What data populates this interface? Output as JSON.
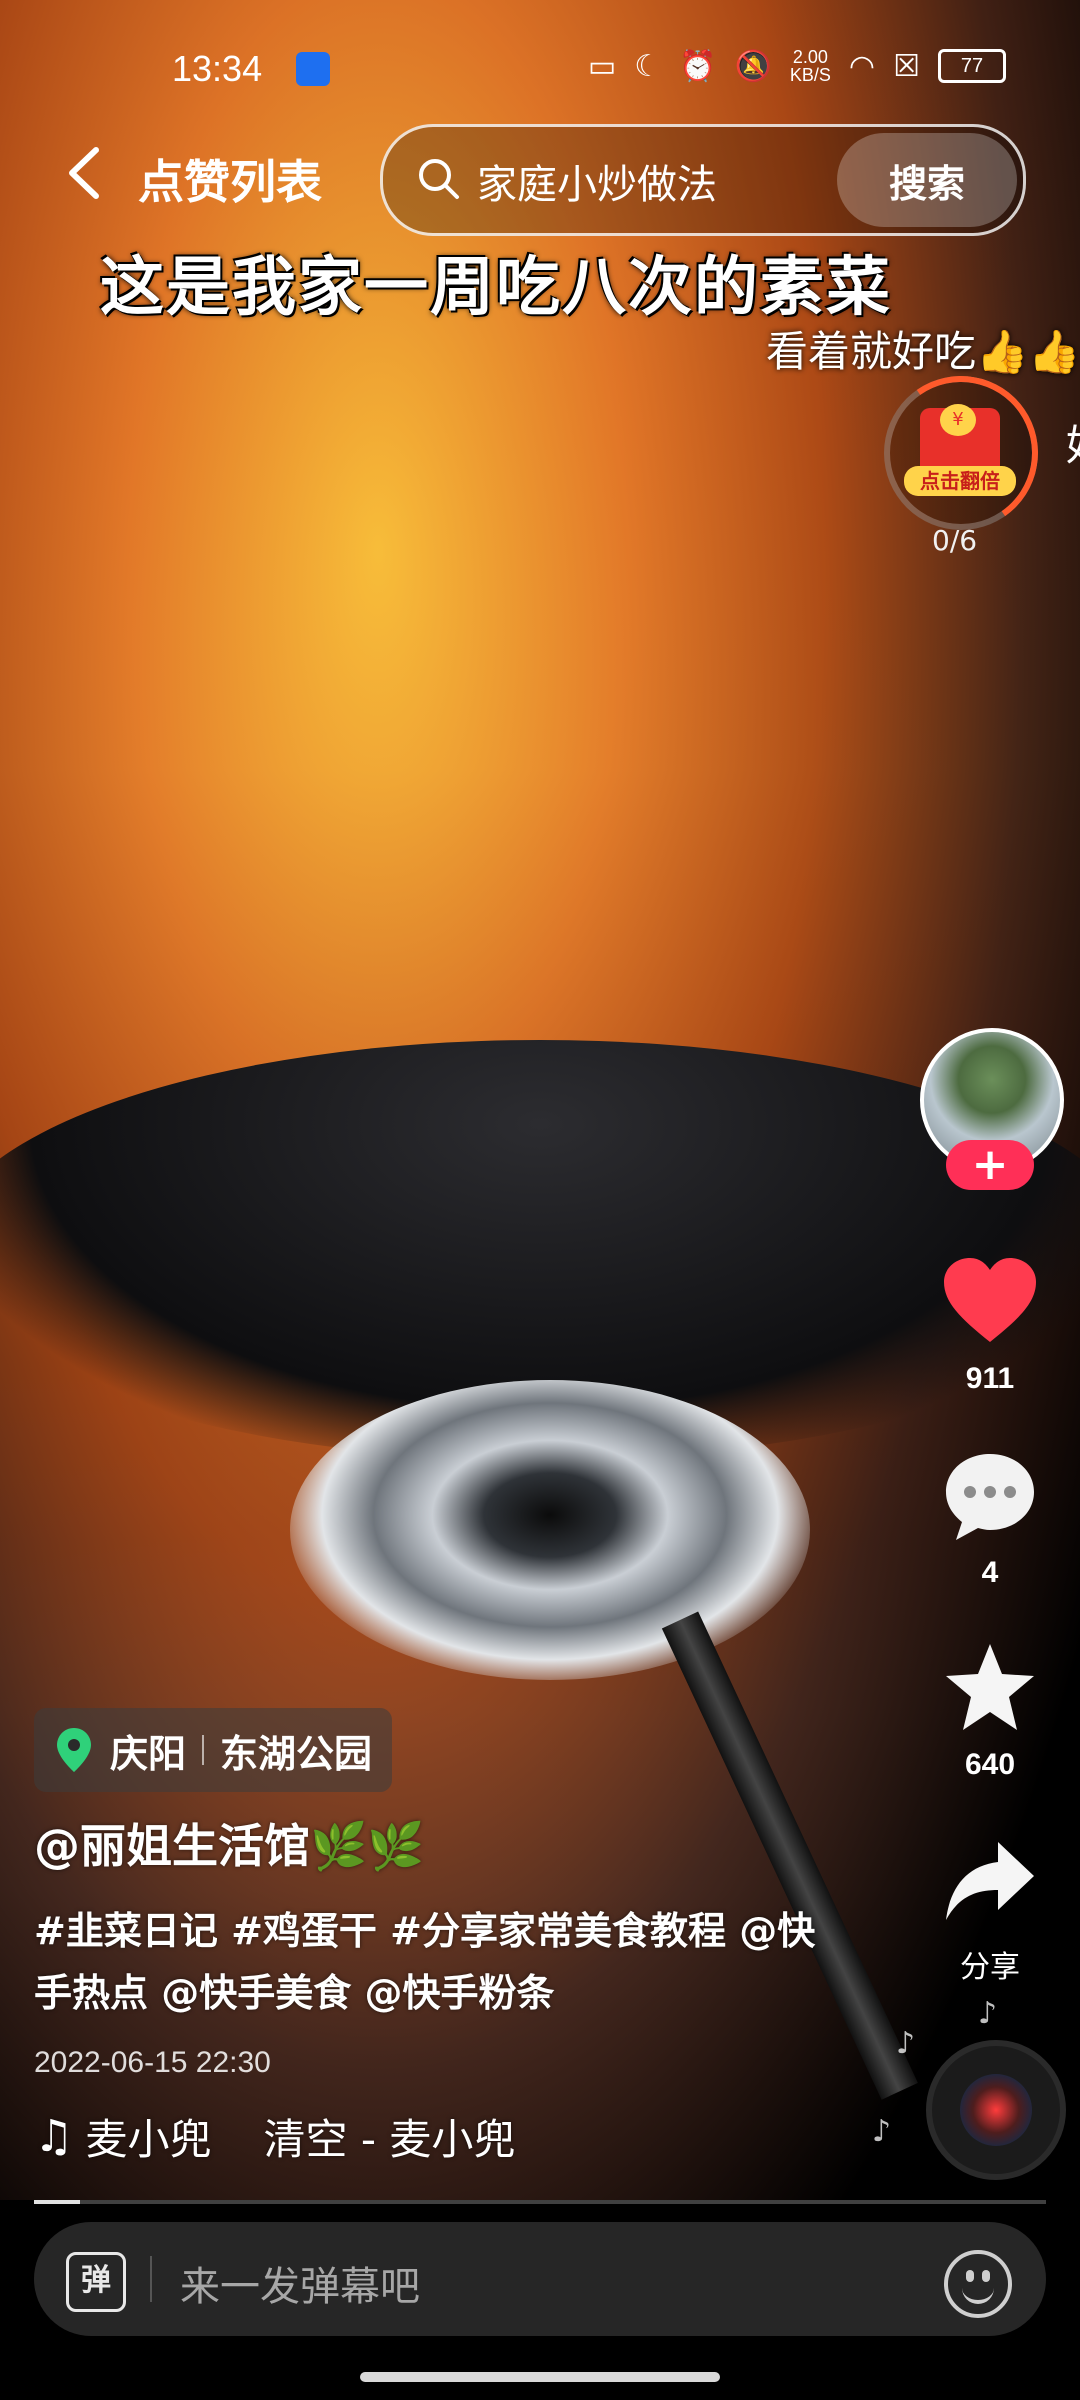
{
  "status_bar": {
    "time": "13:34",
    "network_speed_value": "2.00",
    "network_speed_unit": "KB/S",
    "battery": "77"
  },
  "header": {
    "title": "点赞列表",
    "search_query": "家庭小炒做法",
    "search_button": "搜索"
  },
  "video": {
    "overlay_title": "这是我家一周吃八次的素菜",
    "scrolling_comment": "看着就好吃👍👍",
    "scrolling_comment_next": "好"
  },
  "red_packet": {
    "label": "点击翻倍",
    "coin_symbol": "¥",
    "progress": "0/6"
  },
  "actions": {
    "follow_symbol": "+",
    "likes": "911",
    "comments": "4",
    "favorites": "640",
    "share_label": "分享"
  },
  "post": {
    "location_city": "庆阳",
    "location_place": "东湖公园",
    "author": "@丽姐生活馆🌿🌿",
    "description_line1": "#韭菜日记 #鸡蛋干 #分享家常美食教程 @快",
    "description_line2": "手热点 @快手美食 @快手粉条",
    "date": "2022-06-15 22:30",
    "music_artist": "麦小兜",
    "music_song": "清空 - 麦小兜",
    "music_note": "♫"
  },
  "playback": {
    "progress_fraction": 0.045
  },
  "bottom_bar": {
    "danmu_toggle": "弹",
    "comment_placeholder": "来一发弹幕吧"
  },
  "colors": {
    "like_red": "#ff3b4f",
    "follow_pink": "#ff2f57",
    "red_packet": "#e8302a"
  }
}
